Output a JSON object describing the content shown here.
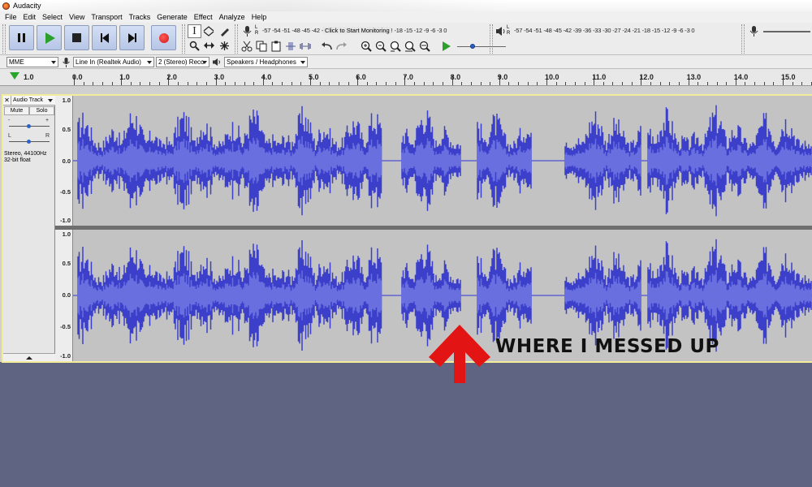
{
  "window": {
    "title": "Audacity",
    "icon": "audacity-icon"
  },
  "menu": [
    "File",
    "Edit",
    "Select",
    "View",
    "Transport",
    "Tracks",
    "Generate",
    "Effect",
    "Analyze",
    "Help"
  ],
  "transport": {
    "buttons": [
      {
        "name": "pause-button",
        "icon": "pause-icon"
      },
      {
        "name": "play-button",
        "icon": "play-icon"
      },
      {
        "name": "stop-button",
        "icon": "stop-icon"
      },
      {
        "name": "skip-to-start-button",
        "icon": "skip-start-icon"
      },
      {
        "name": "skip-to-end-button",
        "icon": "skip-end-icon"
      },
      {
        "name": "record-button",
        "icon": "record-icon"
      }
    ]
  },
  "tools": [
    "selection-tool",
    "envelope-tool",
    "draw-tool",
    "zoom-tool",
    "time-shift-tool",
    "multi-tool"
  ],
  "record_meter": {
    "L": "L",
    "R": "R",
    "scale_left": "-57 -54 -51 -48 -45 -42 -",
    "monitor": "Click to Start Monitoring",
    "scale_right": "! -18 -15 -12 -9 -6 -3 0"
  },
  "playback_meter": {
    "L": "L",
    "R": "R",
    "scale": "-57 -54 -51 -48 -45 -42 -39 -36 -33 -30 -27 -24 -21 -18 -15 -12 -9 -6 -3 0"
  },
  "devices": {
    "host": "MME",
    "input": "Line In (Realtek Audio)",
    "channels": "2 (Stereo) Reco",
    "output": "Speakers / Headphones"
  },
  "ruler": {
    "start_label": "1.0",
    "labels": [
      "0.0",
      "1.0",
      "2.0",
      "3.0",
      "4.0",
      "5.0",
      "6.0",
      "7.0",
      "8.0",
      "9.0",
      "10.0",
      "11.0",
      "12.0",
      "13.0",
      "14.0",
      "15.0"
    ]
  },
  "track": {
    "name": "Audio Track",
    "mute": "Mute",
    "solo": "Solo",
    "gain_minus": "-",
    "gain_plus": "+",
    "pan_left": "L",
    "pan_right": "R",
    "format_line1": "Stereo, 44100Hz",
    "format_line2": "32-bit float",
    "amplitude_labels": [
      "1.0",
      "0.5",
      "0.0",
      "-0.5",
      "-1.0"
    ]
  },
  "annotation": {
    "text": "WHERE I MESSED UP",
    "arrow_color": "#e31414"
  },
  "colors": {
    "waveform": "#3b3fc9",
    "waveform_light": "#6a6fe0",
    "track_bg": "#c3c3c3",
    "desktop": "#5f6483"
  }
}
